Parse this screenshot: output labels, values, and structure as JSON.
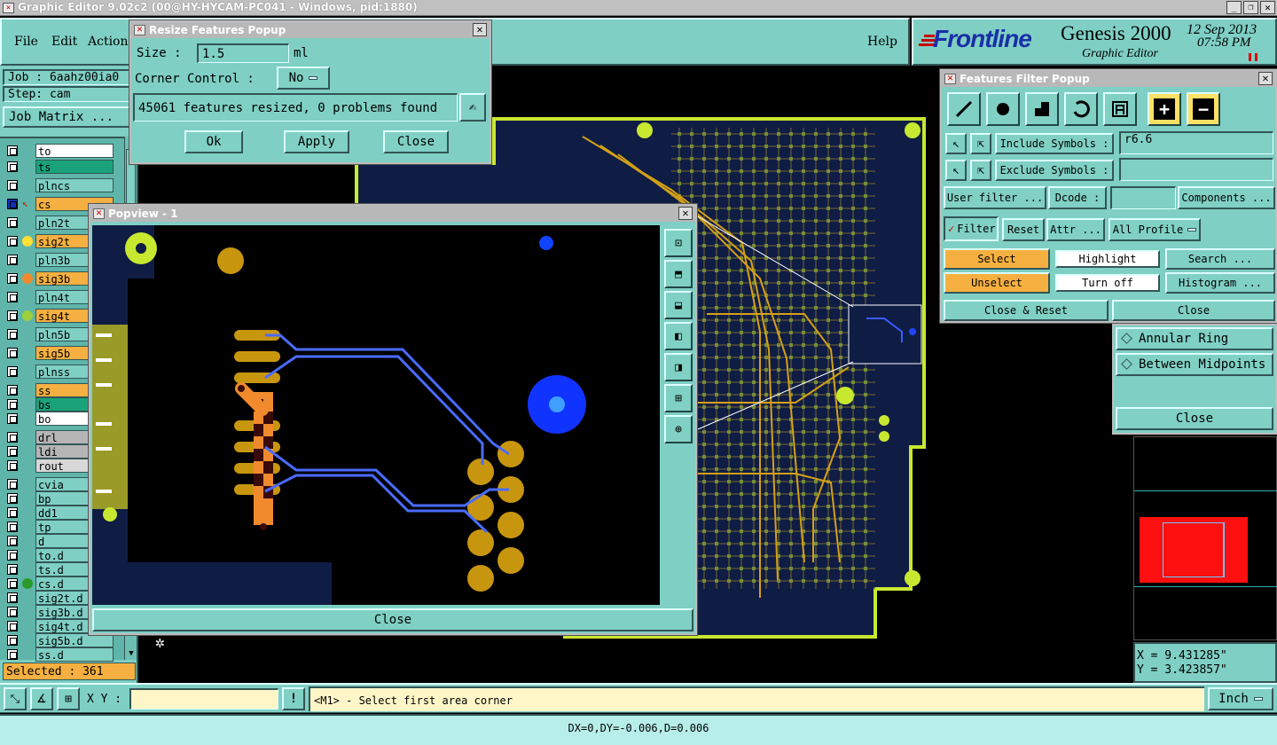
{
  "window": {
    "title": "Graphic Editor 9.02c2 (00@HY-HYCAM-PC041 - Windows, pid:1880)"
  },
  "menu": {
    "file": "File",
    "edit": "Edit",
    "actions": "Actions",
    "help": "Help"
  },
  "brand": {
    "logo": "Frontline",
    "product": "Genesis 2000",
    "module": "Graphic Editor",
    "date": "12 Sep 2013",
    "time": "07:58 PM"
  },
  "job": {
    "job_label": "Job : 6aahz00ia0",
    "step_label": "Step: cam",
    "matrix_button": "Job Matrix ..."
  },
  "layers": [
    {
      "name": "to",
      "color": "#ffffff"
    },
    {
      "name": "ts",
      "color": "#1aa37a"
    },
    {
      "name": "plncs",
      "color": "#7fcfc4"
    },
    {
      "name": "cs",
      "color": "#f5b041"
    },
    {
      "name": "pln2t",
      "color": "#7fcfc4"
    },
    {
      "name": "sig2t",
      "color": "#f5b041"
    },
    {
      "name": "pln3b",
      "color": "#7fcfc4"
    },
    {
      "name": "sig3b",
      "color": "#f5b041"
    },
    {
      "name": "pln4t",
      "color": "#7fcfc4"
    },
    {
      "name": "sig4t",
      "color": "#f5b041"
    },
    {
      "name": "pln5b",
      "color": "#7fcfc4"
    },
    {
      "name": "sig5b",
      "color": "#f5b041"
    },
    {
      "name": "plnss",
      "color": "#7fcfc4"
    },
    {
      "name": "ss",
      "color": "#f5b041"
    },
    {
      "name": "bs",
      "color": "#1aa37a"
    },
    {
      "name": "bo",
      "color": "#ffffff"
    },
    {
      "name": "drl",
      "color": "#b5b5b5"
    },
    {
      "name": "ldi",
      "color": "#b5b5b5"
    },
    {
      "name": "rout",
      "color": "#d8d8d8"
    },
    {
      "name": "cvia",
      "color": "#7fcfc4"
    },
    {
      "name": "bp",
      "color": "#7fcfc4"
    },
    {
      "name": "dd1",
      "color": "#7fcfc4"
    },
    {
      "name": "tp",
      "color": "#7fcfc4"
    },
    {
      "name": "d",
      "color": "#7fcfc4"
    },
    {
      "name": "to.d",
      "color": "#7fcfc4"
    },
    {
      "name": "ts.d",
      "color": "#7fcfc4"
    },
    {
      "name": "cs.d",
      "color": "#7fcfc4"
    },
    {
      "name": "sig2t.d",
      "color": "#7fcfc4"
    },
    {
      "name": "sig3b.d",
      "color": "#7fcfc4"
    },
    {
      "name": "sig4t.d",
      "color": "#7fcfc4"
    },
    {
      "name": "sig5b.d",
      "color": "#7fcfc4"
    },
    {
      "name": "ss.d",
      "color": "#7fcfc4"
    }
  ],
  "selected": "Selected : 361",
  "resize_popup": {
    "title": "Resize Features Popup",
    "size_label": "Size :",
    "size_value": "1.5",
    "size_unit": "ml",
    "corner_label": "Corner Control :",
    "corner_value": "No",
    "status": "45061 features resized, 0 problems found",
    "ok": "Ok",
    "apply": "Apply",
    "close": "Close"
  },
  "popview": {
    "title": "Popview - 1",
    "close": "Close"
  },
  "filter_popup": {
    "title": "Features Filter Popup",
    "include_label": "Include Symbols :",
    "include_value": "r6.6",
    "exclude_label": "Exclude Symbols :",
    "exclude_value": "",
    "user_filter": "User filter ...",
    "dcode_label": "Dcode :",
    "dcode_value": "",
    "components": "Components ...",
    "filter": "Filter",
    "reset": "Reset",
    "attr": "Attr ...",
    "profile": "All Profile",
    "select": "Select",
    "highlight": "Highlight",
    "search": "Search ...",
    "unselect": "Unselect",
    "turn_off": "Turn off",
    "histogram": "Histogram ...",
    "close_reset": "Close & Reset",
    "close": "Close"
  },
  "snap_panel": {
    "annular": "Annular Ring",
    "midpoints": "Between Midpoints",
    "close": "Close"
  },
  "coords": {
    "x": "X = 9.431285\"",
    "y": "Y = 3.423857\""
  },
  "bottom": {
    "xy_label": "X Y :",
    "xy_value": "",
    "prompt": "<M1> - Select first area corner",
    "units": "Inch",
    "status": "DX=0,DY=-0.006,D=0.006"
  },
  "colors": {
    "panel": "#7fcfc4",
    "board": "#0f1d45",
    "outline": "#c8e830",
    "copper": "#d4a017"
  }
}
